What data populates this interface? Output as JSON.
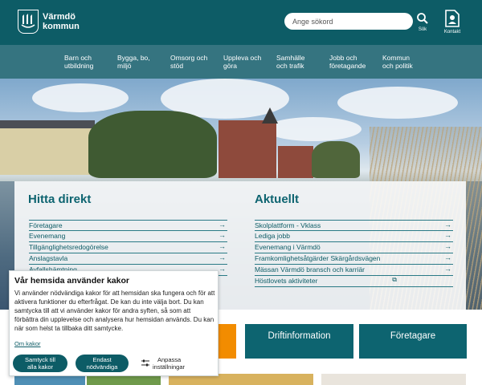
{
  "header": {
    "logo_text_line1": "Värmdö",
    "logo_text_line2": "kommun",
    "search_placeholder": "Ange sökord",
    "search_label": "Sök",
    "contact_label": "Kontakt"
  },
  "nav": {
    "items": [
      {
        "l1": "Barn och",
        "l2": "utbildning"
      },
      {
        "l1": "Bygga, bo,",
        "l2": "miljö"
      },
      {
        "l1": "Omsorg och",
        "l2": "stöd"
      },
      {
        "l1": "Uppleva och",
        "l2": "göra"
      },
      {
        "l1": "Samhälle",
        "l2": "och trafik"
      },
      {
        "l1": "Jobb och",
        "l2": "företagande"
      },
      {
        "l1": "Kommun",
        "l2": "och politik"
      }
    ]
  },
  "hitta": {
    "title": "Hitta direkt",
    "links": [
      "Företagare",
      "Evenemang",
      "Tillgänglighetsredogörelse",
      "Anslagstavla",
      "Avfallshämtning"
    ]
  },
  "aktuellt": {
    "title": "Aktuellt",
    "links": [
      "Skolplattform - Vklass",
      "Lediga jobb",
      "Evenemang i Värmdö",
      "Framkomlighetsåtgärder Skärgårdsvägen",
      "Mässan Värmdö bransch och karriär",
      "Höstlovets aktiviteter"
    ]
  },
  "cards": {
    "first_suffix": "n",
    "driftinfo": "Driftinformation",
    "foretagare": "Företagare"
  },
  "cookie": {
    "title": "Vår hemsida använder kakor",
    "text": "Vi använder nödvändiga kakor för att hemsidan ska fungera och för att aktivera funktioner du efterfrågat. De kan du inte välja bort. Du kan samtycka till att vi använder kakor för andra syften, så som att förbättra din upplevelse och analysera hur hemsidan används. Du kan när som helst ta tillbaka ditt samtycke.",
    "more_link": "Om kakor",
    "accept_l1": "Samtyck till",
    "accept_l2": "alla kakor",
    "necessary_l1": "Endast",
    "necessary_l2": "nödvändiga",
    "customize_l1": "Anpassa",
    "customize_l2": "inställningar"
  },
  "colors": {
    "header_bg": "#0d5c66",
    "nav_bg": "#357480",
    "accent_orange": "#f28c00",
    "card_teal": "#0d6470"
  }
}
